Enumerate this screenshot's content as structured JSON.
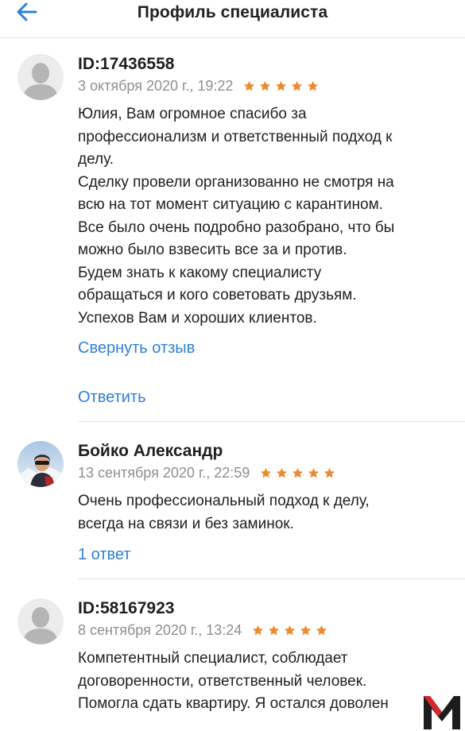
{
  "header": {
    "title": "Профиль специалиста",
    "back_icon": "arrow-left-icon"
  },
  "colors": {
    "accent": "#2f7fd8",
    "star": "#f0892d",
    "muted": "#8e8e8e"
  },
  "reviews": [
    {
      "author": "ID:17436558",
      "date": "3 октября 2020 г., 19:22",
      "rating": 5,
      "avatar": "default-avatar",
      "lines": [
        "Юлия, Вам огромное спасибо за",
        "профессионализм и ответственный подход к",
        "делу.",
        "Сделку провели организованно не смотря на",
        "всю на тот момент ситуацию с карантином.",
        "Все было очень подробно разобрано, что бы",
        "можно было взвесить все за и против.",
        "Будем знать к какому специалисту",
        "обращаться и кого советовать друзьям.",
        "Успехов Вам и хороших клиентов."
      ],
      "collapse_label": "Свернуть отзыв",
      "reply_label": "Ответить"
    },
    {
      "author": "Бойко Александр",
      "date": "13 сентября 2020 г., 22:59",
      "rating": 5,
      "avatar": "photo-avatar",
      "lines": [
        "Очень профессиональный подход к делу,",
        "всегда на связи и без заминок."
      ],
      "replies_label": "1 ответ"
    },
    {
      "author": "ID:58167923",
      "date": "8 сентября 2020 г., 13:24",
      "rating": 5,
      "avatar": "default-avatar",
      "lines": [
        "Компетентный специалист, соблюдает",
        "договоренности, ответственный человек.",
        "Помогла сдать квартиру. Я остался доволен"
      ]
    }
  ],
  "watermark": {
    "icon": "m-logo-icon"
  }
}
